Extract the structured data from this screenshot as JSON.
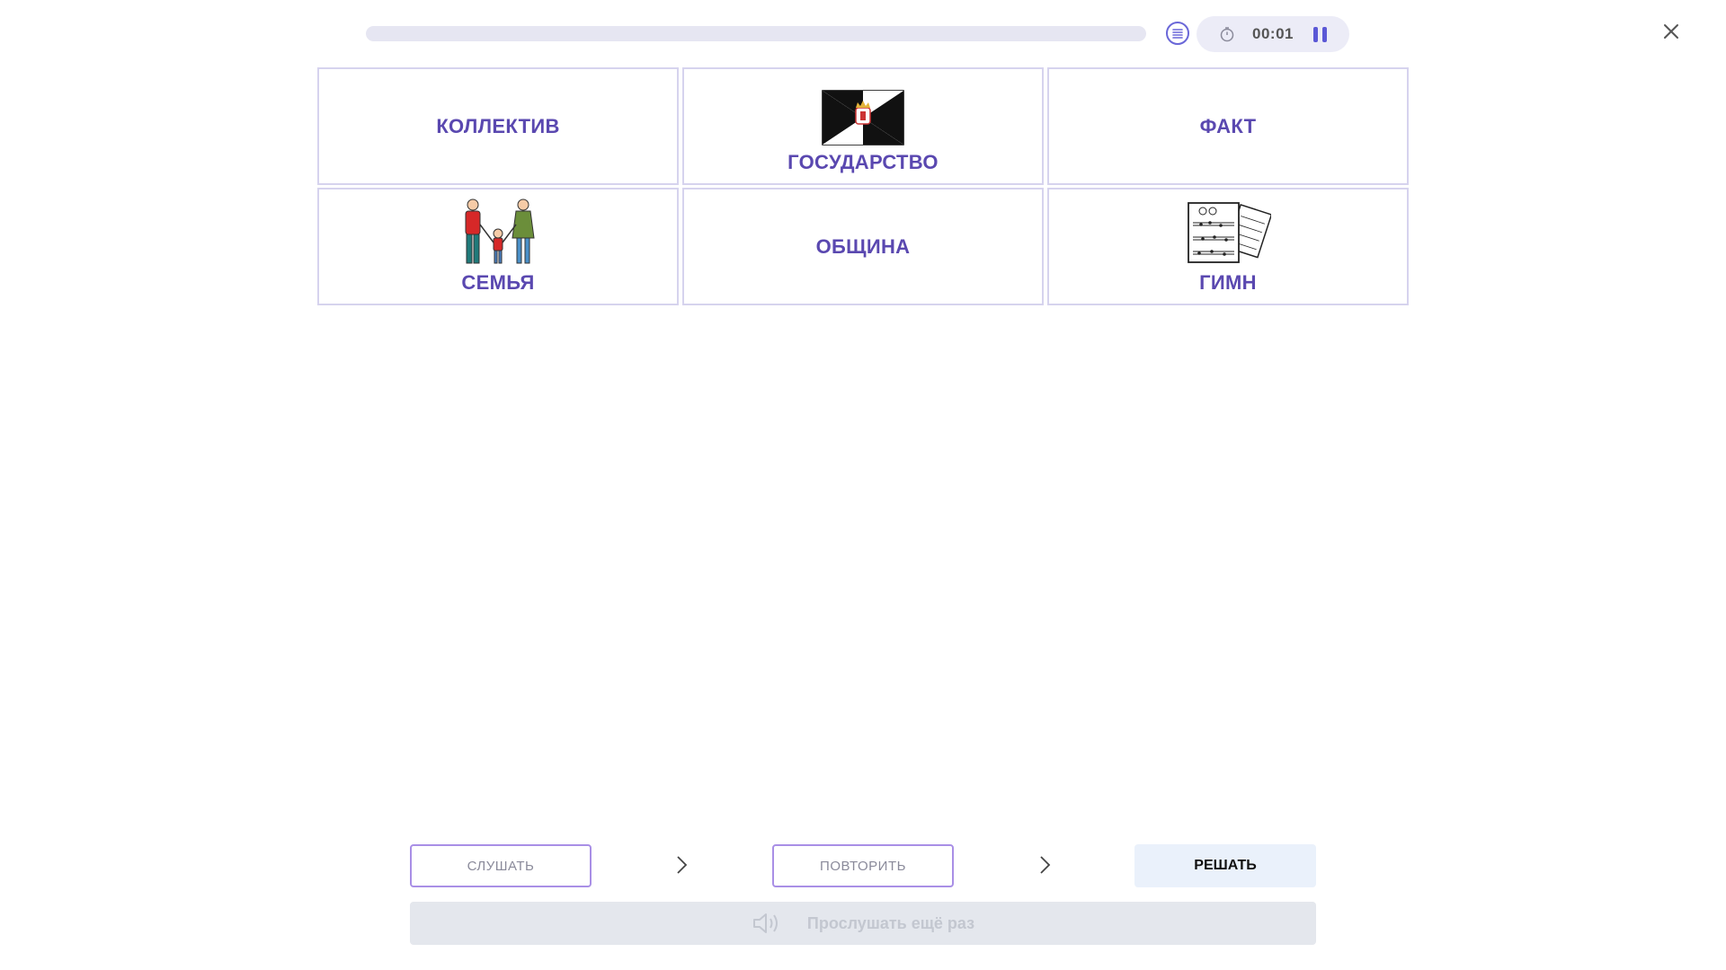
{
  "header": {
    "progress_fraction": 0,
    "timer_text": "00:01"
  },
  "cards": [
    {
      "label": "КОЛЛЕКТИВ",
      "pictogram": null
    },
    {
      "label": "ГОСУДАРСТВО",
      "pictogram": "flag-icon"
    },
    {
      "label": "ФАКТ",
      "pictogram": null
    },
    {
      "label": "СЕМЬЯ",
      "pictogram": "family-icon"
    },
    {
      "label": "ОБЩИНА",
      "pictogram": null
    },
    {
      "label": "ГИМН",
      "pictogram": "sheet-music-icon"
    }
  ],
  "steps": {
    "listen_label": "СЛУШАТЬ",
    "repeat_label": "ПОВТОРИТЬ",
    "solve_label": "РЕШАТЬ"
  },
  "listen_again": {
    "label": "Прослушать ещё раз",
    "icon": "speaker-icon"
  },
  "colors": {
    "accent": "#5b58d6",
    "card_label": "#5a48b0",
    "progress_track": "#e6e6f2"
  }
}
